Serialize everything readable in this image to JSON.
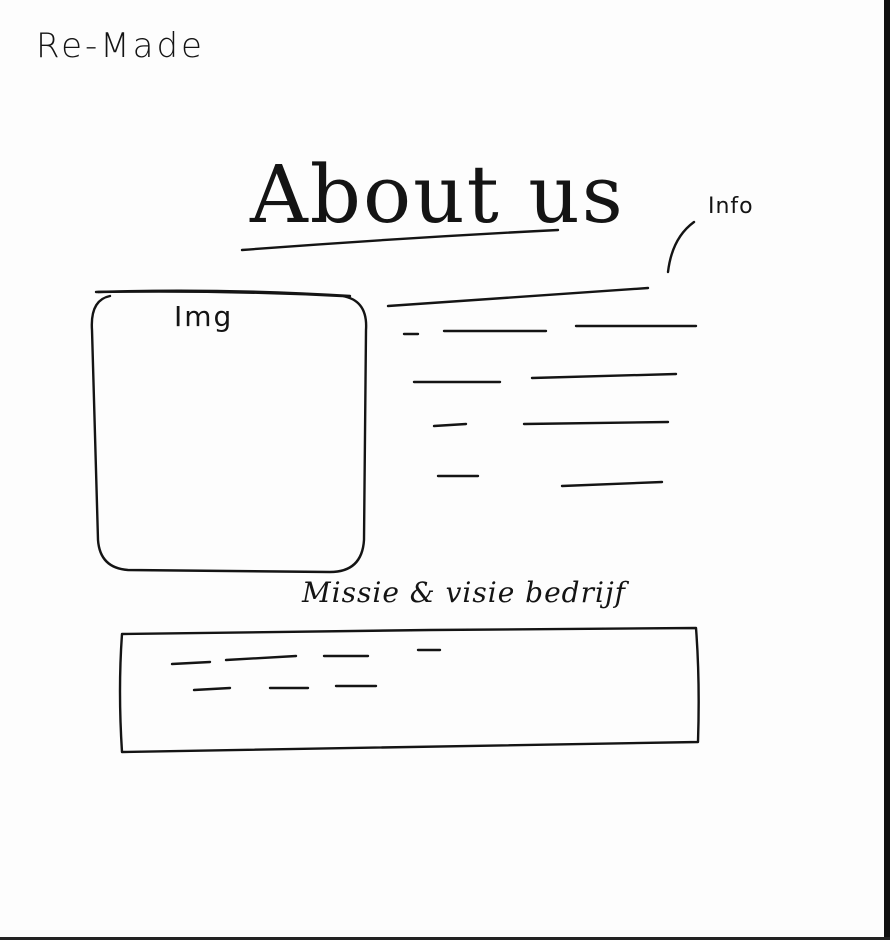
{
  "sketch": {
    "corner_note": "Re-Made",
    "title": "About us",
    "info_label": "Info",
    "image_label": "Img",
    "mission_label": "Missie & visie bedrijf"
  }
}
